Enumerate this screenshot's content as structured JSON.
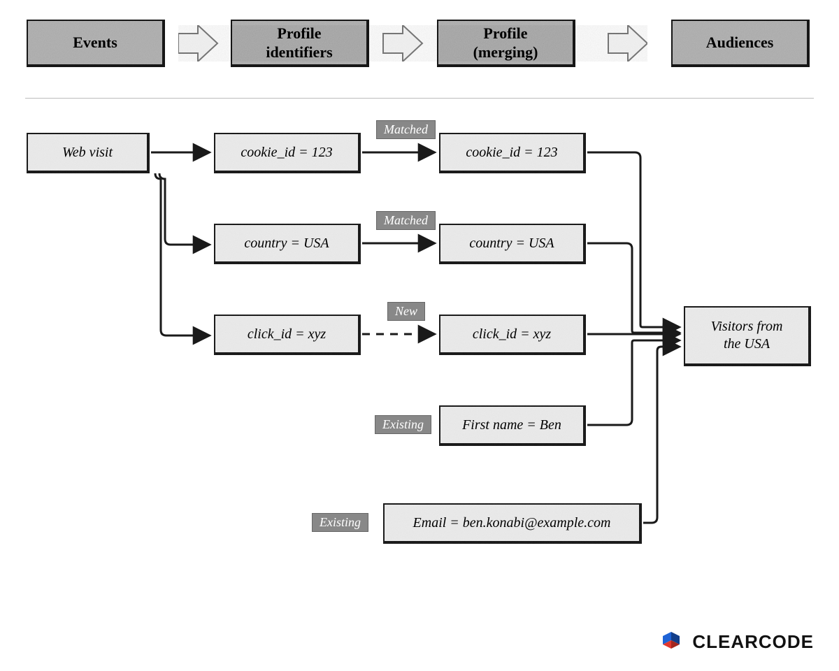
{
  "headers": {
    "events": "Events",
    "identifiers": "Profile\nidentifiers",
    "merging": "Profile\n(merging)",
    "audiences": "Audiences"
  },
  "event_box": "Web visit",
  "identifier_boxes": {
    "cookie": "cookie_id = 123",
    "country": "country = USA",
    "click": "click_id = xyz"
  },
  "merge_boxes": {
    "cookie": "cookie_id = 123",
    "country": "country = USA",
    "click": "click_id = xyz",
    "firstname": "First name = Ben",
    "email": "Email = ben.konabi@example.com"
  },
  "audience_box": "Visitors from\nthe USA",
  "badges": {
    "matched1": "Matched",
    "matched2": "Matched",
    "new": "New",
    "existing1": "Existing",
    "existing2": "Existing"
  },
  "brand": "CLEARCODE",
  "colors": {
    "header_bg": "#b6b6b6",
    "light_bg": "#ececec",
    "badge_bg": "#8a8a8a",
    "stroke": "#1a1a1a",
    "logo_blue": "#1e63d6",
    "logo_red": "#e2382e"
  }
}
